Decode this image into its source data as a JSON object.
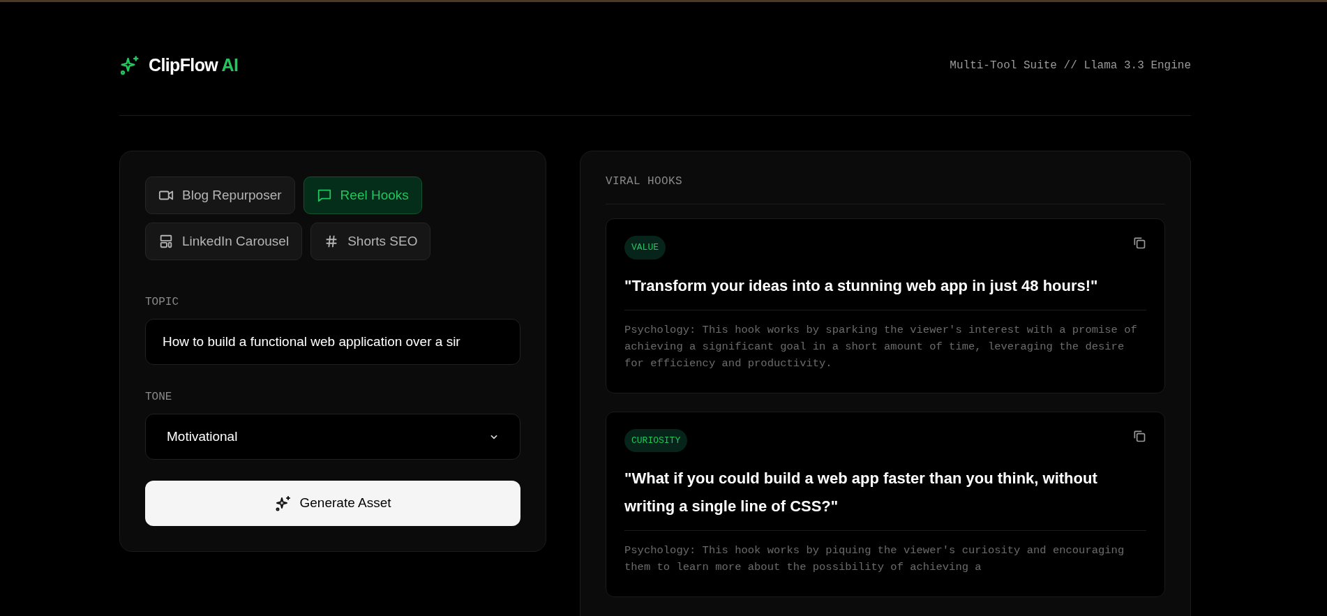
{
  "brand": {
    "name": "ClipFlow",
    "accent": "AI"
  },
  "engine_label": "Multi-Tool Suite // Llama 3.3 Engine",
  "tools": [
    {
      "kind": "video",
      "label": "Blog Repurposer",
      "selected": false
    },
    {
      "kind": "chat",
      "label": "Reel Hooks",
      "selected": true
    },
    {
      "kind": "layout",
      "label": "LinkedIn Carousel",
      "selected": false
    },
    {
      "kind": "hash",
      "label": "Shorts SEO",
      "selected": false
    }
  ],
  "topic": {
    "label": "TOPIC",
    "value": "How to build a functional web application over a sir"
  },
  "tone": {
    "label": "TONE",
    "value": "Motivational"
  },
  "generate_button": "Generate Asset",
  "results": {
    "title": "VIRAL HOOKS",
    "hooks": [
      {
        "tag": "VALUE",
        "hook": "\"Transform your ideas into a stunning web app in just 48 hours!\"",
        "psychology": "Psychology: This hook works by sparking the viewer's interest with a promise of achieving a significant goal in a short amount of time, leveraging the desire for efficiency and productivity."
      },
      {
        "tag": "CURIOSITY",
        "hook": "\"What if you could build a web app faster than you think, without writing a single line of CSS?\"",
        "psychology": "Psychology: This hook works by piquing the viewer's curiosity and encouraging them to learn more about the possibility of achieving a"
      }
    ]
  }
}
